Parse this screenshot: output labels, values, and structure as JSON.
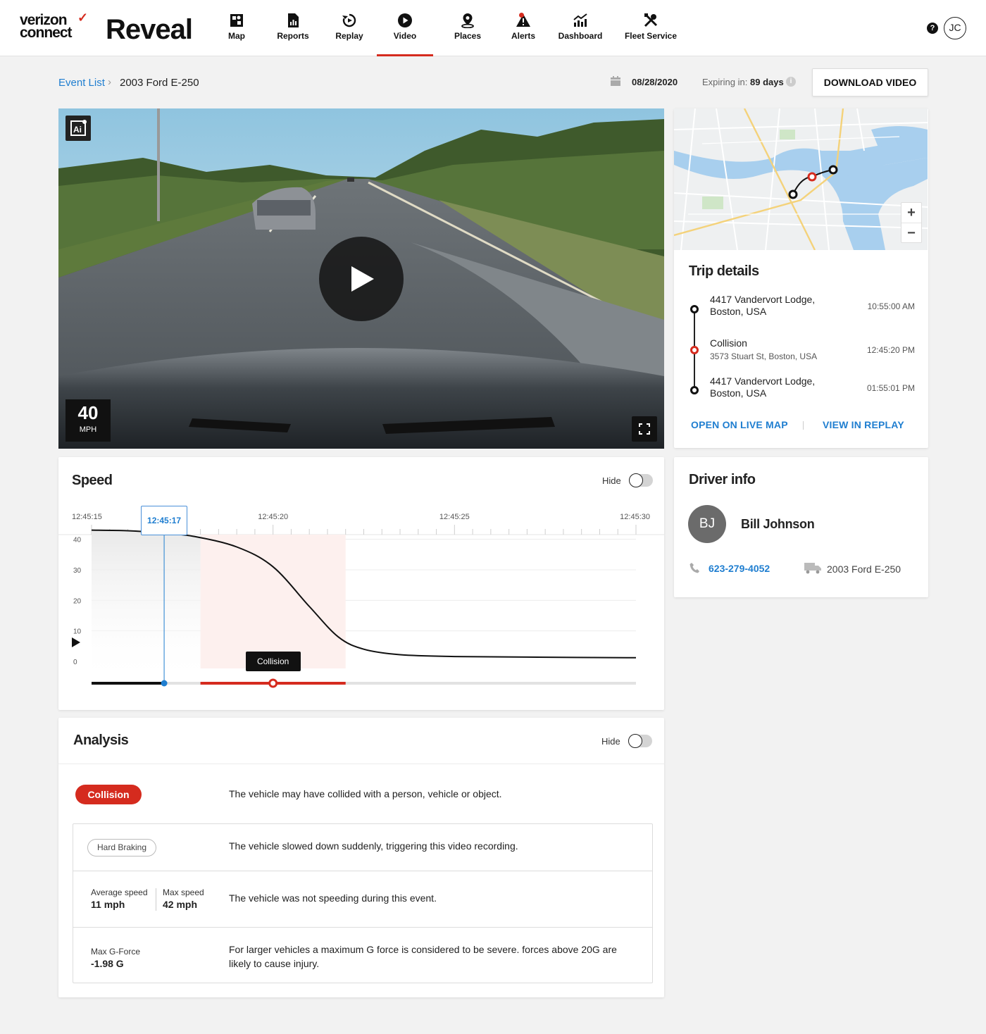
{
  "header": {
    "brand_line1": "verizon",
    "brand_line2": "connect",
    "brand_check": "✓",
    "product": "Reveal",
    "nav": [
      {
        "label": "Map",
        "icon": "map-icon"
      },
      {
        "label": "Reports",
        "icon": "reports-icon"
      },
      {
        "label": "Replay",
        "icon": "replay-icon"
      },
      {
        "label": "Video",
        "icon": "video-icon",
        "active": true
      },
      {
        "label": "Places",
        "icon": "places-icon"
      },
      {
        "label": "Alerts",
        "icon": "alerts-icon"
      },
      {
        "label": "Dashboard",
        "icon": "dashboard-icon"
      },
      {
        "label": "Fleet Service",
        "icon": "fleet-service-icon"
      }
    ],
    "help": "?",
    "user_initials": "JC"
  },
  "breadcrumb": {
    "parent": "Event List",
    "separator": "›",
    "current": "2003 Ford E-250"
  },
  "event": {
    "date": "08/28/2020",
    "expiring_label": "Expiring in:",
    "expiring_value": "89 days",
    "info": "i",
    "download_label": "DOWNLOAD VIDEO"
  },
  "video": {
    "ai_badge_icon": "ai-icon",
    "speed_value": "40",
    "speed_unit": "MPH"
  },
  "trip": {
    "title": "Trip details",
    "stops": [
      {
        "place": "4417 Vandervort Lodge, Boston, USA",
        "time": "10:55:00 AM"
      },
      {
        "place": "Collision",
        "sub": "3573 Stuart St, Boston, USA",
        "time": "12:45:20 PM"
      },
      {
        "place": "4417 Vandervort Lodge, Boston, USA",
        "time": "01:55:01 PM"
      }
    ],
    "open_live_map": "OPEN ON LIVE MAP",
    "view_replay": "VIEW IN REPLAY",
    "zoom_in": "+",
    "zoom_out": "−"
  },
  "speed": {
    "title": "Speed",
    "hide_label": "Hide",
    "cursor_time": "12:45:17",
    "collision_label": "Collision"
  },
  "driver": {
    "title": "Driver info",
    "initials": "BJ",
    "name": "Bill Johnson",
    "phone": "623-279-4052",
    "vehicle": "2003 Ford E-250"
  },
  "analysis": {
    "title": "Analysis",
    "hide_label": "Hide",
    "collision_label": "Collision",
    "collision_text": "The vehicle may have collided with a person, vehicle or object.",
    "hard_braking_label": "Hard Braking",
    "hard_braking_text": "The vehicle slowed down suddenly, triggering this video recording.",
    "avg_speed_label": "Average speed",
    "avg_speed_value": "11 mph",
    "max_speed_label": "Max speed",
    "max_speed_value": "42 mph",
    "speeding_text": "The vehicle was not speeding during this event.",
    "gforce_label": "Max G-Force",
    "gforce_value": "-1.98 G",
    "gforce_text": "For larger vehicles a maximum G force is considered to be severe. forces above 20G are likely to cause injury."
  },
  "chart_data": {
    "type": "line",
    "title": "Speed",
    "x_ticks": [
      "12:45:15",
      "12:45:20",
      "12:45:25",
      "12:45:30"
    ],
    "y_ticks": [
      0,
      10,
      20,
      30,
      40
    ],
    "xlim": [
      0,
      15
    ],
    "ylim": [
      0,
      45
    ],
    "series": [
      {
        "values": [
          [
            0,
            43
          ],
          [
            1,
            42.8
          ],
          [
            2,
            42
          ],
          [
            2.8,
            41
          ],
          [
            4,
            37.5
          ],
          [
            5,
            31
          ],
          [
            6,
            18
          ],
          [
            6.8,
            8
          ],
          [
            7.5,
            4
          ],
          [
            8.5,
            2.2
          ],
          [
            10,
            1.6
          ],
          [
            12,
            1.4
          ],
          [
            15,
            1.2
          ]
        ]
      }
    ],
    "cursor_x": 2,
    "collision_x": 5,
    "highlight_range": [
      3,
      7
    ],
    "colors": {
      "line": "#111111",
      "highlight": "#fdf0ee",
      "cursor": "#1f7ed0",
      "event": "#d52b1e"
    }
  }
}
